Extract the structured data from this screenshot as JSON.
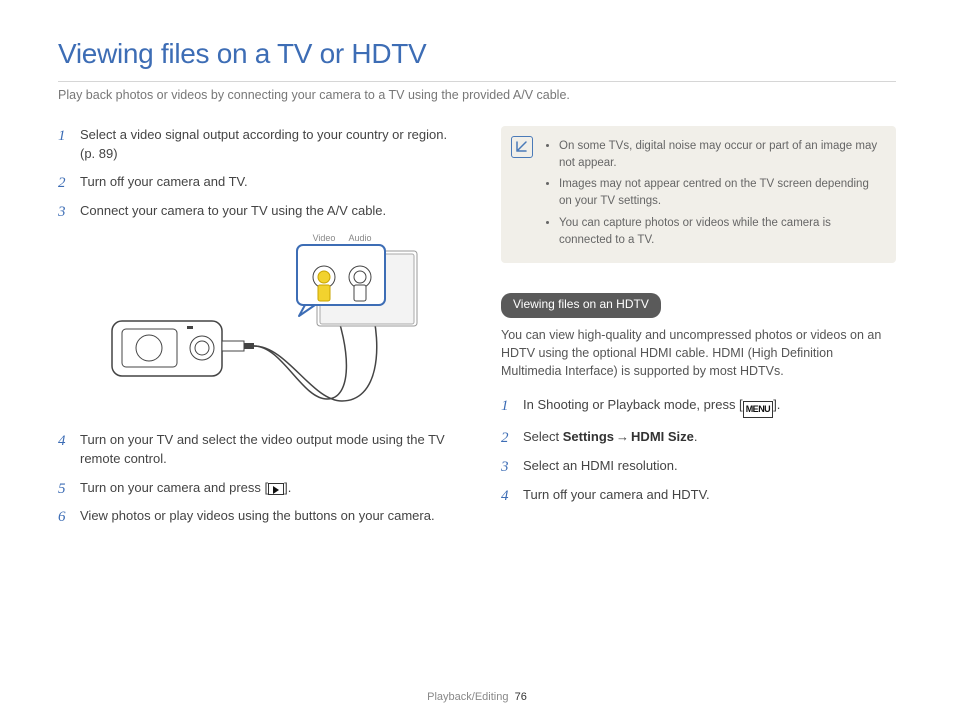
{
  "title": "Viewing files on a TV or HDTV",
  "intro": "Play back photos or videos by connecting your camera to a TV using the provided A/V cable.",
  "diagram": {
    "video_label": "Video",
    "audio_label": "Audio"
  },
  "left_steps": {
    "s1": "Select a video signal output according to your country or region. (p. 89)",
    "s2": "Turn off your camera and TV.",
    "s3": "Connect your camera to your TV using the A/V cable.",
    "s4": "Turn on your TV and select the video output mode using the TV remote control.",
    "s5_a": "Turn on your camera and press [",
    "s5_b": "].",
    "s6": "View photos or play videos using the buttons on your camera."
  },
  "notes": {
    "n1": "On some TVs, digital noise may occur or part of an image may not appear.",
    "n2": "Images may not appear centred on the TV screen depending on your TV settings.",
    "n3": "You can capture photos or videos while the camera is connected to a TV."
  },
  "hdtv": {
    "heading": "Viewing files on an HDTV",
    "paragraph": "You can view high-quality and uncompressed photos or videos on an HDTV using the optional HDMI cable. HDMI (High Definition Multimedia Interface) is supported by most HDTVs.",
    "s1_a": "In Shooting or Playback mode, press [",
    "s1_menu": "MENU",
    "s1_b": "].",
    "s2_a": "Select ",
    "s2_settings": "Settings",
    "s2_arrow": "→",
    "s2_hdmi": "HDMI Size",
    "s2_b": ".",
    "s3": "Select an HDMI resolution.",
    "s4": "Turn off your camera and HDTV."
  },
  "footer": {
    "section": "Playback/Editing",
    "page": "76"
  }
}
